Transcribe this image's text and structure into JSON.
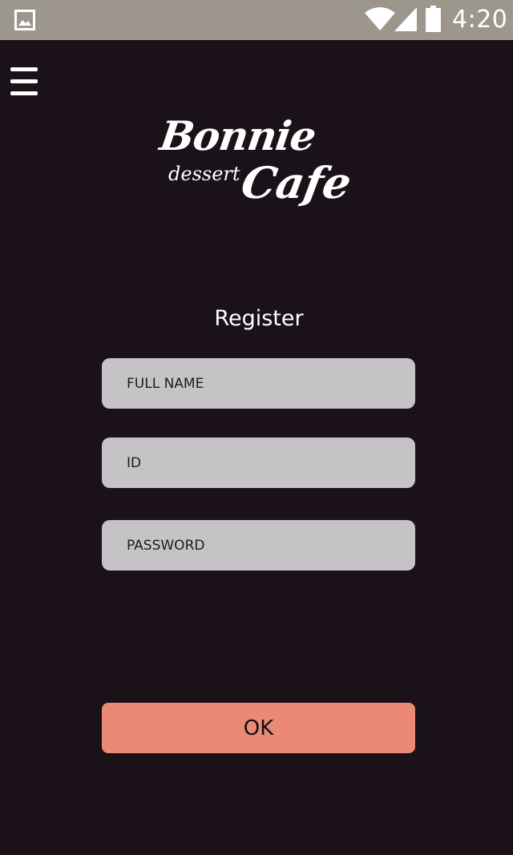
{
  "status_bar": {
    "time": "4:20",
    "notification_icon": "gallery-icon",
    "wifi_icon": "wifi-icon",
    "signal_icon": "cellular-signal-icon",
    "battery_icon": "battery-icon",
    "background_color": "#9d968c"
  },
  "header": {
    "menu_icon": "hamburger-menu-icon"
  },
  "logo": {
    "line1": "Bonnie",
    "line2_small": "dessert",
    "line2_large": "Cafe"
  },
  "form": {
    "title": "Register",
    "full_name_placeholder": "FULL NAME",
    "id_placeholder": "ID",
    "password_placeholder": "PASSWORD",
    "submit_label": "OK"
  },
  "colors": {
    "background": "#1a1119",
    "field_background": "#c5c3c6",
    "button_background": "#ea8a76",
    "text_light": "#ffffff"
  }
}
